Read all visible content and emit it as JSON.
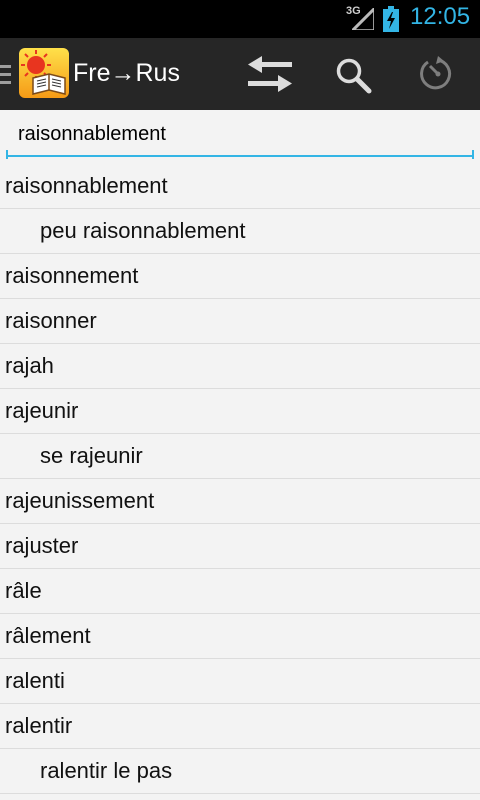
{
  "status_bar": {
    "network": "3G",
    "time": "12:05",
    "icons": [
      "signal-icon",
      "battery-charging-icon"
    ]
  },
  "action_bar": {
    "title": "Fre→Rus",
    "icons": [
      "menu-icon",
      "app-logo-icon",
      "swap-icon",
      "search-icon",
      "history-icon"
    ]
  },
  "search": {
    "value": "raisonnablement"
  },
  "colors": {
    "accent": "#33b5e5",
    "action_bar": "#262626",
    "background": "#f3f3f3"
  },
  "words": [
    {
      "text": "raisonnablement",
      "sub": false
    },
    {
      "text": "peu raisonnablement",
      "sub": true
    },
    {
      "text": "raisonnement",
      "sub": false
    },
    {
      "text": "raisonner",
      "sub": false
    },
    {
      "text": "rajah",
      "sub": false
    },
    {
      "text": "rajeunir",
      "sub": false
    },
    {
      "text": "se rajeunir",
      "sub": true
    },
    {
      "text": "rajeunissement",
      "sub": false
    },
    {
      "text": "rajuster",
      "sub": false
    },
    {
      "text": "râle",
      "sub": false
    },
    {
      "text": "râlement",
      "sub": false
    },
    {
      "text": "ralenti",
      "sub": false
    },
    {
      "text": "ralentir",
      "sub": false
    },
    {
      "text": "ralentir le pas",
      "sub": true
    }
  ]
}
